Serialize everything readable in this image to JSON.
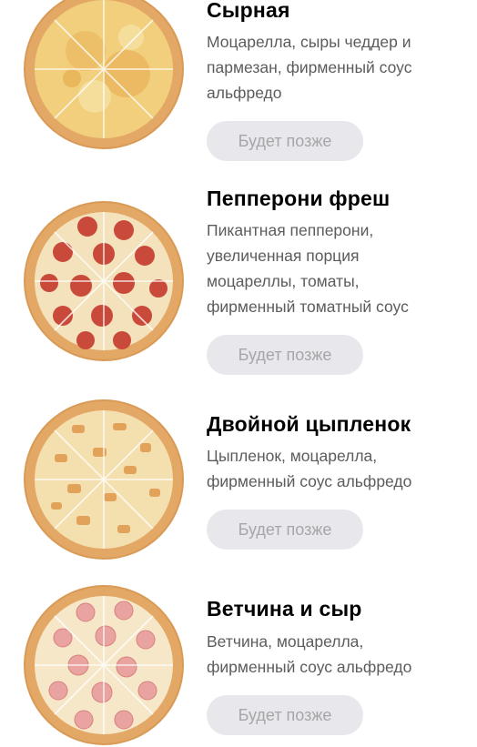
{
  "products": [
    {
      "title": "Сырная",
      "description_lines": [
        "Моцарелла, сыры чеддер и",
        "пармезан, фирменный соус",
        "альфредо"
      ],
      "button_label": "Будет позже",
      "image_icon": "cheese-pizza-image"
    },
    {
      "title": "Пепперони фреш",
      "description_lines": [
        "Пикантная пепперони,",
        "увеличенная порция",
        "моцареллы, томаты,",
        "фирменный томатный соус"
      ],
      "button_label": "Будет позже",
      "image_icon": "pepperoni-pizza-image"
    },
    {
      "title": "Двойной цыпленок",
      "description_lines": [
        "Цыпленок, моцарелла,",
        "фирменный соус альфредо"
      ],
      "button_label": "Будет позже",
      "image_icon": "chicken-pizza-image"
    },
    {
      "title": "Ветчина и сыр",
      "description_lines": [
        "Ветчина, моцарелла,",
        "фирменный соус альфредо"
      ],
      "button_label": "Будет позже",
      "image_icon": "ham-cheese-pizza-image"
    }
  ],
  "colors": {
    "button_bg": "#e8e8ec",
    "button_text": "#a6a6a9",
    "title_text": "#000000",
    "description_text": "#5c5c5c",
    "crust": "#d99a55",
    "cheese": "#f3d58a",
    "pepperoni": "#c94a3a",
    "ham": "#e9a3a0"
  }
}
